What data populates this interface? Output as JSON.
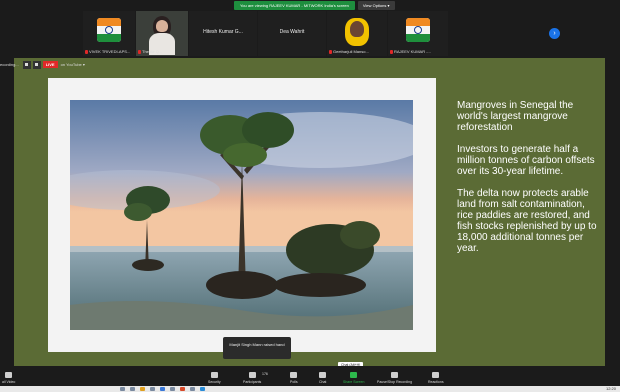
{
  "notice": {
    "text": "You are viewing RAJEEV KUMAR - MITWORK India's screen",
    "button": "View Options ▾"
  },
  "participants": [
    {
      "name": "VIVEK TRIVEDI-APS...",
      "type": "logo",
      "muted": true
    },
    {
      "name": "The Air Q...",
      "type": "video",
      "muted": true
    },
    {
      "name": "Hitesh Kumar G...",
      "type": "name"
    },
    {
      "name": "Dea Wahrit",
      "type": "name"
    },
    {
      "name": "Geetharjuli Manso...",
      "type": "portrait",
      "muted": true
    },
    {
      "name": "RAJEEV KUMAR -...",
      "type": "logo",
      "muted": true
    }
  ],
  "livebar": {
    "recording_label": "ecording...",
    "live_label": "LIVE",
    "youtube_label": "on YouTube ▾"
  },
  "slide": {
    "text": [
      "Mangroves in Senegal the world's largest mangrove reforestation",
      "Investors to generate half a million tonnes of carbon offsets over its 30-year lifetime.",
      "The delta now protects arable land from salt contamination, rice paddies are restored, and fish stocks replenished by up to 18,000 additional tonnes per year."
    ],
    "colors": {
      "background": "#5b6b35",
      "frame": "#f3f3f3"
    }
  },
  "toast": {
    "text": "Manjit Singh Mann raised hand"
  },
  "controls": {
    "video": "ail Video",
    "security": "Security",
    "participants": "Participants",
    "participants_count": "176",
    "polls": "Polls",
    "chat": "Chat",
    "share_screen": "Share Screen",
    "pause_recording": "Pause/Stop Recording",
    "reactions": "Reactions",
    "tooltip": "Chat (Alt+H)"
  },
  "taskbar": {
    "time": "12:20"
  }
}
